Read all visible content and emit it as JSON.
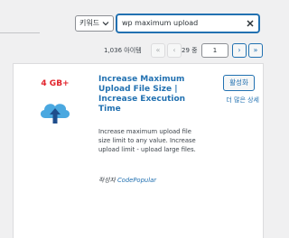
{
  "search": {
    "filter_label": "키워드",
    "query": "wp maximum upload"
  },
  "pagination": {
    "item_count": "1,036 아이템",
    "first": "«",
    "prev": "‹",
    "current_page": "1",
    "of_label": "29 중",
    "next": "›",
    "last": "»"
  },
  "plugin": {
    "storage_badge": "4 GB+",
    "title": "Increase Maximum Upload File Size | Increase Execution Time",
    "activate_label": "활성화",
    "more_details_label": "더 많은 상세",
    "description": "Increase maximum upload file size limit to any value. Increase upload limit - upload large files.",
    "author_prefix": "작성자",
    "author_name": "CodePopular"
  },
  "colors": {
    "accent": "#2271b1",
    "badge_red": "#e2232b",
    "cloud_blue": "#4aa8e0",
    "arrow_navy": "#1f4e8c"
  },
  "icons": {
    "filter_chevron": "chevron-down-icon",
    "search_clear": "close-icon",
    "plugin_icon": "cloud-upload-icon"
  }
}
